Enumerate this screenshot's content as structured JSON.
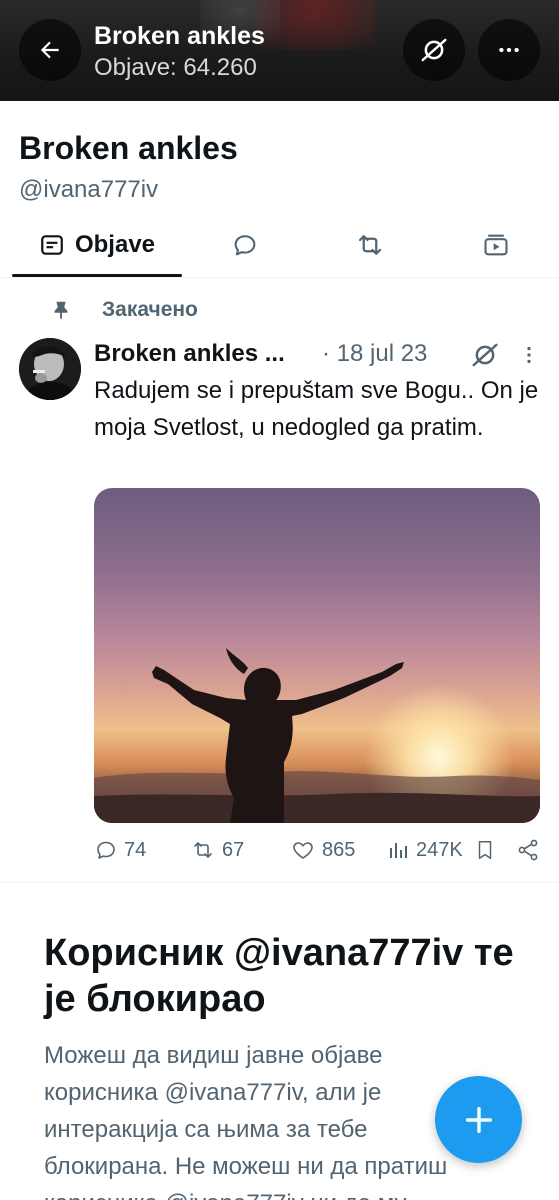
{
  "header": {
    "title": "Broken ankles",
    "posts_count": "Objave: 64.260"
  },
  "profile": {
    "name": "Broken ankles",
    "handle": "@ivana777iv"
  },
  "tabs": [
    {
      "label": "Objave",
      "icon": "posts-icon",
      "active": true
    },
    {
      "label": "",
      "icon": "replies-icon",
      "active": false
    },
    {
      "label": "",
      "icon": "reposts-icon",
      "active": false
    },
    {
      "label": "",
      "icon": "media-icon",
      "active": false
    }
  ],
  "pinned_label": "Закачено",
  "post": {
    "author": "Broken ankles ...",
    "date": "· 18 jul 23",
    "text": "Radujem se i prepuštam sve  Bogu.. On je moja Svetlost, u nedogled ga pratim.",
    "stats": {
      "replies": "74",
      "reposts": "67",
      "likes": "865",
      "views": "247K"
    }
  },
  "blocked": {
    "title": "Корисник @ivana777iv те је блокирао",
    "text": "Можеш да видиш јавне објаве корисника @ivana777iv,  али је интеракција са њима за тебе блокирана. Не можеш ни да пратиш корисника @ivana777iv ни да му"
  },
  "colors": {
    "accent": "#1d9bf0",
    "text_primary": "#0f1419",
    "text_secondary": "#536471"
  }
}
